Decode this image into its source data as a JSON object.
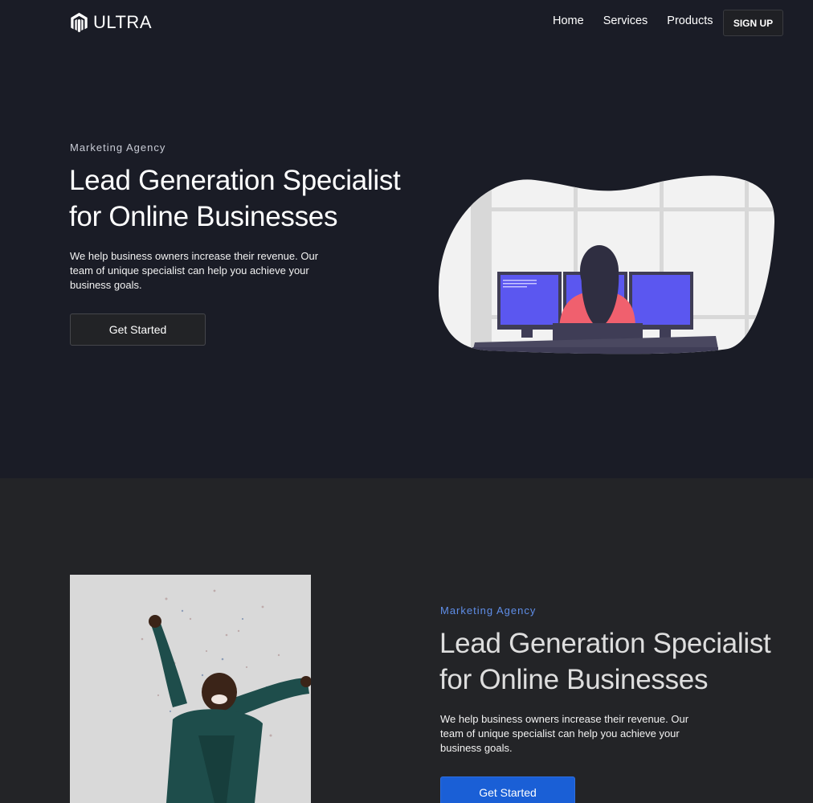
{
  "brand": {
    "name": "ULTRA",
    "icon": "magento-logo-icon"
  },
  "nav": {
    "links": [
      "Home",
      "Services",
      "Products"
    ],
    "signup_label": "SIGN UP"
  },
  "hero": {
    "eyebrow": "Marketing Agency",
    "title_line1": "Lead Generation Specialist",
    "title_line2": "for Online Businesses",
    "description": "We help business owners increase their revenue. Our team of unique specialist can help you achieve your business goals.",
    "cta_label": "Get Started",
    "illustration": "woman-at-computers-illustration"
  },
  "feature": {
    "image": "celebrating-woman-confetti-photo",
    "eyebrow": "Marketing Agency",
    "title_line1": "Lead Generation Specialist",
    "title_line2": "for Online Businesses",
    "description": "We help business owners increase their revenue. Our team of unique specialist can help you achieve your business goals.",
    "cta_label": "Get Started"
  },
  "colors": {
    "hero_bg": "#1a1c26",
    "feature_bg": "#232427",
    "accent_blue": "#1a5fd6",
    "eyebrow_blue": "#5f8ee8",
    "monitor_screen": "#5b57f0",
    "person_shirt": "#f0606e"
  }
}
